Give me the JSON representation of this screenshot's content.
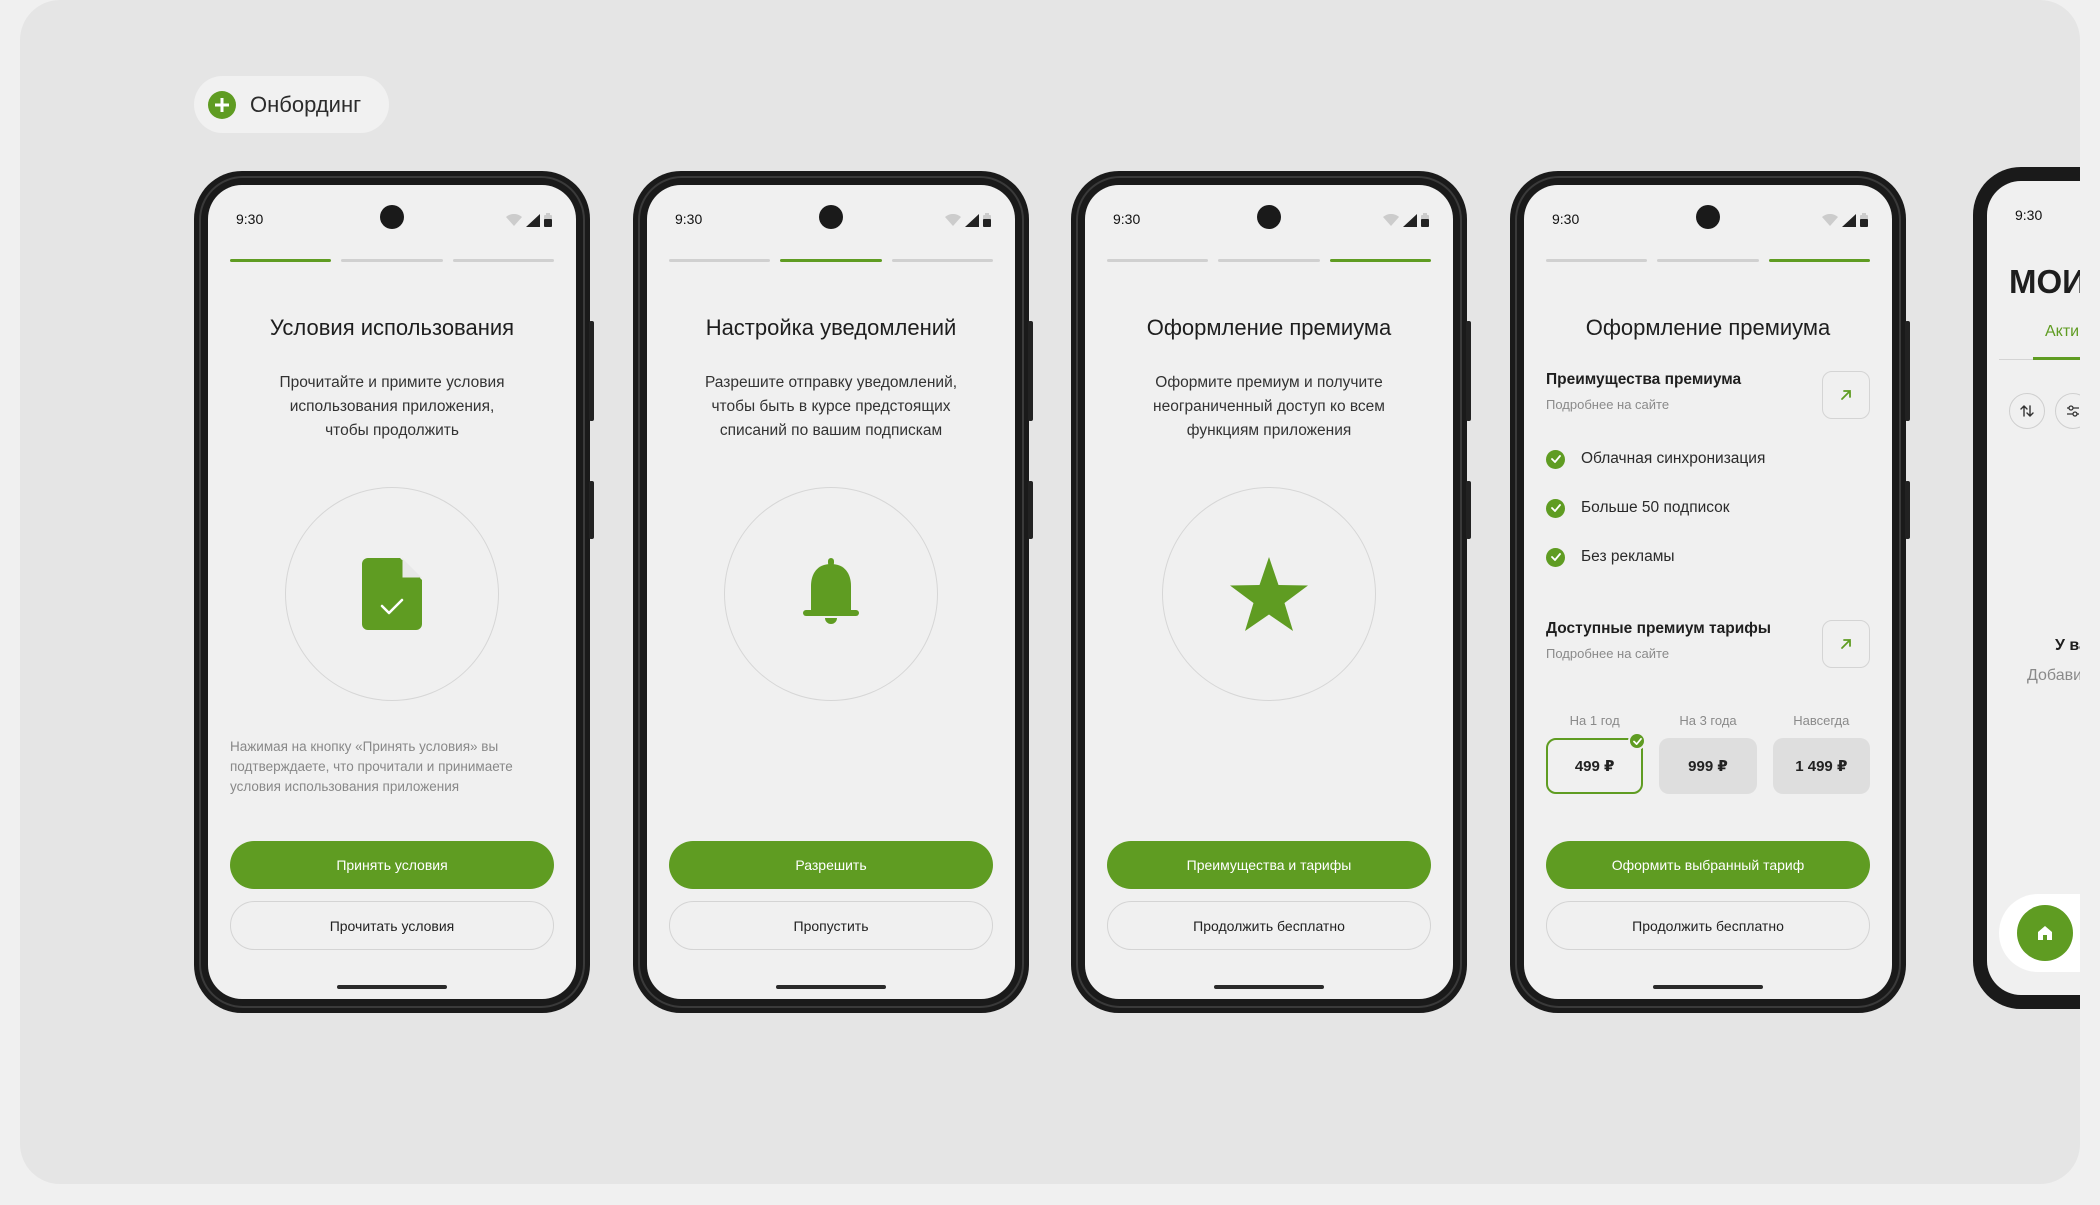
{
  "section_chip": {
    "label": "Онбординг"
  },
  "status_time": "9:30",
  "screens": [
    {
      "title": "Условия использования",
      "description": [
        "Прочитайте и примите условия",
        "использования приложения,",
        "чтобы продолжить"
      ],
      "icon": "document-check-icon",
      "note": [
        "Нажимая на кнопку «Принять условия» вы",
        "подтверждаете, что прочитали и принимаете",
        "условия использования приложения"
      ],
      "primary_label": "Принять условия",
      "secondary_label": "Прочитать условия"
    },
    {
      "title": "Настройка уведомлений",
      "description": [
        "Разрешите отправку уведомлений,",
        "чтобы быть в курсе предстоящих",
        "списаний по вашим подпискам"
      ],
      "icon": "bell-icon",
      "primary_label": "Разрешить",
      "secondary_label": "Пропустить"
    },
    {
      "title": "Оформление премиума",
      "description": [
        "Оформите премиум и получите",
        "неограниченный доступ ко всем",
        "функциям приложения"
      ],
      "icon": "star-icon",
      "primary_label": "Преимущества и тарифы",
      "secondary_label": "Продолжить бесплатно"
    },
    {
      "title": "Оформление премиума",
      "benefits_title": "Преимущества премиума",
      "benefits_sub": "Подробнее на сайте",
      "features": [
        "Облачная синхронизация",
        "Больше 50 подписок",
        "Без рекламы"
      ],
      "plans_title": "Доступные премиум тарифы",
      "plans_sub": "Подробнее на сайте",
      "plans": [
        {
          "label": "На 1 год",
          "price": "499 ₽",
          "selected": true
        },
        {
          "label": "На 3 года",
          "price": "999 ₽",
          "selected": false
        },
        {
          "label": "Навсегда",
          "price": "1 499 ₽",
          "selected": false
        }
      ],
      "primary_label": "Оформить выбранный тариф",
      "secondary_label": "Продолжить бесплатно"
    }
  ],
  "partial_screen": {
    "title": "МОИ П",
    "tab": "Активн",
    "empty_title": "У вас",
    "empty_action": "Добавить"
  },
  "colors": {
    "accent": "#5f9c22",
    "background": "#e5e5e5"
  }
}
